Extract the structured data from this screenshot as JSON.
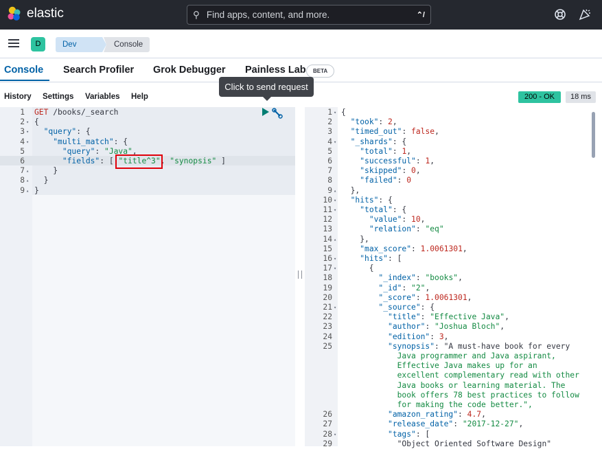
{
  "app": {
    "name": "elastic"
  },
  "search": {
    "placeholder": "Find apps, content, and more.",
    "shortcut": "⌃/"
  },
  "space": {
    "initial": "D"
  },
  "breadcrumbs": [
    "Dev Tools",
    "Console"
  ],
  "tabs": [
    {
      "label": "Console",
      "active": true
    },
    {
      "label": "Search Profiler"
    },
    {
      "label": "Grok Debugger"
    },
    {
      "label": "Painless Lab",
      "badge": "BETA"
    }
  ],
  "tooltip": "Click to send request",
  "menu": [
    "History",
    "Settings",
    "Variables",
    "Help"
  ],
  "response_status": {
    "status": "200 - OK",
    "time": "18 ms"
  },
  "editor_lines": [
    {
      "n": "1",
      "fold": "",
      "text": "GET /books/_search"
    },
    {
      "n": "2",
      "fold": "▾",
      "text": "{"
    },
    {
      "n": "3",
      "fold": "▾",
      "text": "  \"query\": {"
    },
    {
      "n": "4",
      "fold": "▾",
      "text": "    \"multi_match\": {"
    },
    {
      "n": "5",
      "fold": "",
      "text": "      \"query\": \"Java\","
    },
    {
      "n": "6",
      "fold": "",
      "text": "      \"fields\": [ \"title^3\", \"synopsis\" ]"
    },
    {
      "n": "7",
      "fold": "▴",
      "text": "    }"
    },
    {
      "n": "8",
      "fold": "▴",
      "text": "  }"
    },
    {
      "n": "9",
      "fold": "▴",
      "text": "}"
    }
  ],
  "output_lines": [
    {
      "n": "1",
      "fold": "▾",
      "text": "{"
    },
    {
      "n": "2",
      "fold": "",
      "text": "  \"took\": 2,"
    },
    {
      "n": "3",
      "fold": "",
      "text": "  \"timed_out\": false,"
    },
    {
      "n": "4",
      "fold": "▾",
      "text": "  \"_shards\": {"
    },
    {
      "n": "5",
      "fold": "",
      "text": "    \"total\": 1,"
    },
    {
      "n": "6",
      "fold": "",
      "text": "    \"successful\": 1,"
    },
    {
      "n": "7",
      "fold": "",
      "text": "    \"skipped\": 0,"
    },
    {
      "n": "8",
      "fold": "",
      "text": "    \"failed\": 0"
    },
    {
      "n": "9",
      "fold": "▴",
      "text": "  },"
    },
    {
      "n": "10",
      "fold": "▾",
      "text": "  \"hits\": {"
    },
    {
      "n": "11",
      "fold": "▾",
      "text": "    \"total\": {"
    },
    {
      "n": "12",
      "fold": "",
      "text": "      \"value\": 10,"
    },
    {
      "n": "13",
      "fold": "",
      "text": "      \"relation\": \"eq\""
    },
    {
      "n": "14",
      "fold": "▴",
      "text": "    },"
    },
    {
      "n": "15",
      "fold": "",
      "text": "    \"max_score\": 1.0061301,"
    },
    {
      "n": "16",
      "fold": "▾",
      "text": "    \"hits\": ["
    },
    {
      "n": "17",
      "fold": "▾",
      "text": "      {"
    },
    {
      "n": "18",
      "fold": "",
      "text": "        \"_index\": \"books\","
    },
    {
      "n": "19",
      "fold": "",
      "text": "        \"_id\": \"2\","
    },
    {
      "n": "20",
      "fold": "",
      "text": "        \"_score\": 1.0061301,"
    },
    {
      "n": "21",
      "fold": "▾",
      "text": "        \"_source\": {"
    },
    {
      "n": "22",
      "fold": "",
      "text": "          \"title\": \"Effective Java\","
    },
    {
      "n": "23",
      "fold": "",
      "text": "          \"author\": \"Joshua Bloch\","
    },
    {
      "n": "24",
      "fold": "",
      "text": "          \"edition\": 3,"
    },
    {
      "n": "25",
      "fold": "",
      "text": "          \"synopsis\": \"A must-have book for every"
    },
    {
      "n": "",
      "fold": "",
      "text": "            Java programmer and Java aspirant,"
    },
    {
      "n": "",
      "fold": "",
      "text": "            Effective Java makes up for an"
    },
    {
      "n": "",
      "fold": "",
      "text": "            excellent complementary read with other"
    },
    {
      "n": "",
      "fold": "",
      "text": "            Java books or learning material. The"
    },
    {
      "n": "",
      "fold": "",
      "text": "            book offers 78 best practices to follow"
    },
    {
      "n": "",
      "fold": "",
      "text": "            for making the code better.\","
    },
    {
      "n": "26",
      "fold": "",
      "text": "          \"amazon_rating\": 4.7,"
    },
    {
      "n": "27",
      "fold": "",
      "text": "          \"release_date\": \"2017-12-27\","
    },
    {
      "n": "28",
      "fold": "▾",
      "text": "          \"tags\": ["
    },
    {
      "n": "29",
      "fold": "",
      "text": "            \"Object Oriented Software Design\""
    }
  ]
}
